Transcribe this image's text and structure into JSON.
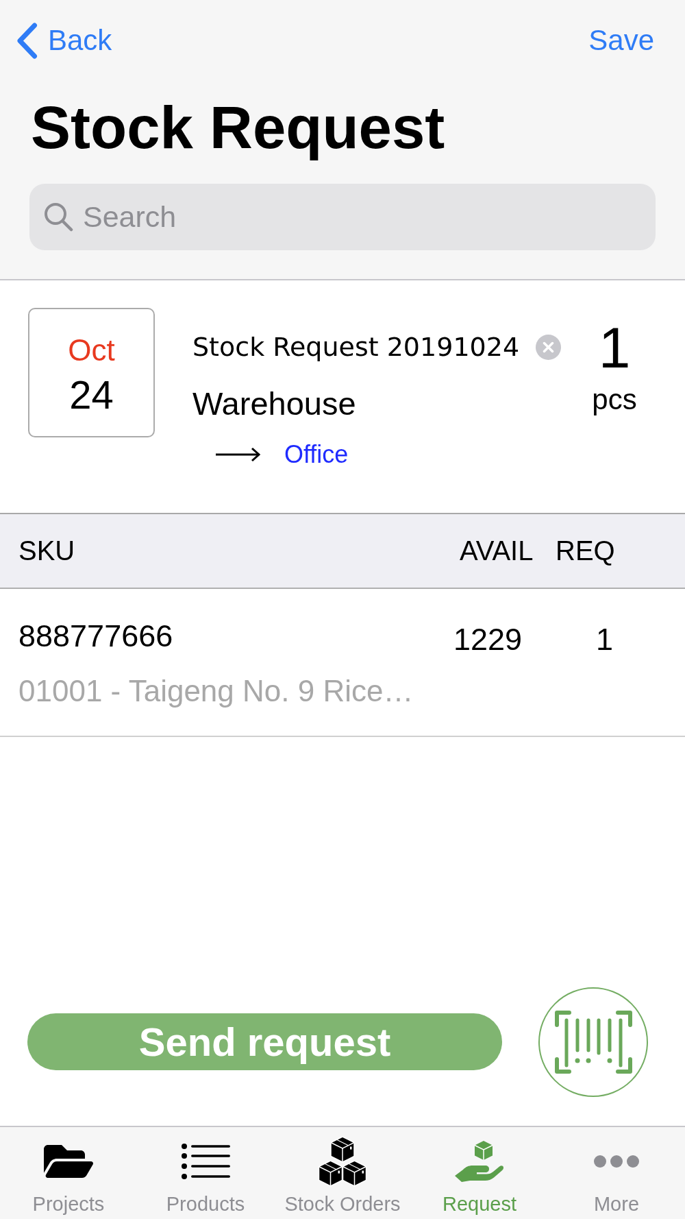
{
  "nav_bar": {
    "back": "Back",
    "action": "Save",
    "title": "Stock Request"
  },
  "search": {
    "placeholder": "Search"
  },
  "request": {
    "month": "Oct",
    "day": "24",
    "name": "Stock Request 20191024",
    "from": "Warehouse",
    "to": "Office",
    "quantity": "1",
    "unit": "pcs"
  },
  "table": {
    "columns": [
      "SKU",
      "AVAIL",
      "REQ"
    ],
    "rows": [
      {
        "sku": "888777666",
        "description": "01001 - Taigeng No. 9 Rice…",
        "avail": "1229",
        "req": "1"
      }
    ]
  },
  "send_button": "Send request",
  "tab_bar": [
    {
      "label": "Projects",
      "selected": false
    },
    {
      "label": "Products",
      "selected": false
    },
    {
      "label": "Stock Orders",
      "selected": false
    },
    {
      "label": "Request",
      "selected": true
    },
    {
      "label": "More",
      "selected": false
    }
  ]
}
